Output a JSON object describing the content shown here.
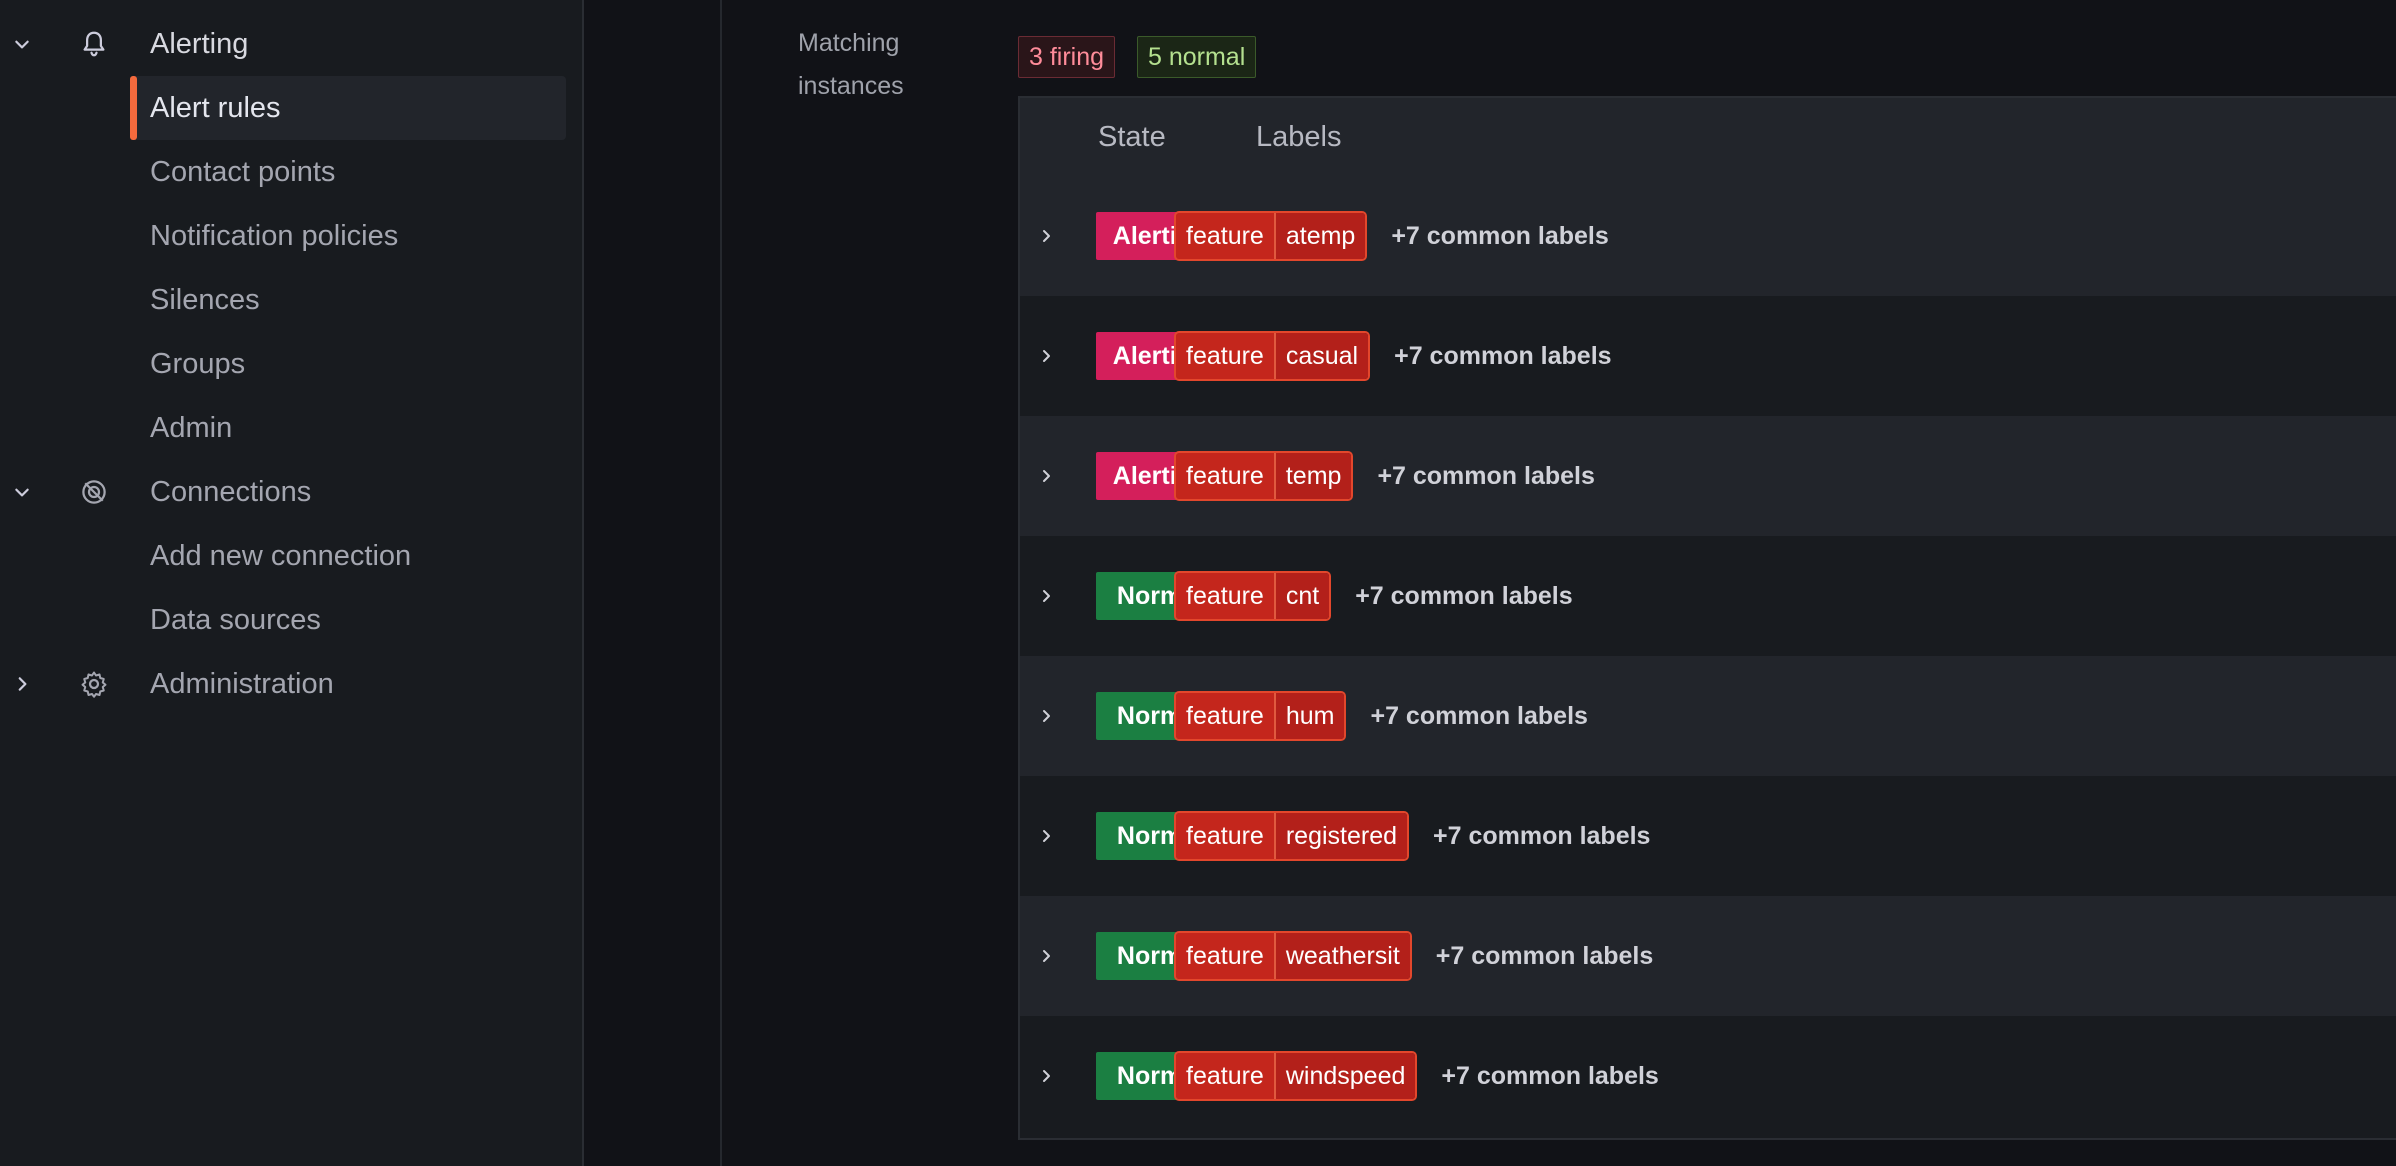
{
  "sidebar": {
    "alerting": {
      "label": "Alerting",
      "icon": "bell-icon",
      "expanded": true
    },
    "alerting_items": [
      {
        "label": "Alert rules",
        "active": true
      },
      {
        "label": "Contact points"
      },
      {
        "label": "Notification policies"
      },
      {
        "label": "Silences"
      },
      {
        "label": "Groups"
      },
      {
        "label": "Admin"
      }
    ],
    "connections": {
      "label": "Connections",
      "icon": "connections-icon",
      "expanded": true
    },
    "connections_items": [
      {
        "label": "Add new connection"
      },
      {
        "label": "Data sources"
      }
    ],
    "administration": {
      "label": "Administration",
      "icon": "gear-icon",
      "expanded": false
    }
  },
  "main": {
    "field_label_line1": "Matching",
    "field_label_line2": "instances",
    "firing_badge": "3 firing",
    "normal_badge": "5 normal",
    "table": {
      "headers": {
        "state": "State",
        "labels": "Labels"
      },
      "rows": [
        {
          "state": "Alerting",
          "label_key": "feature",
          "label_value": "atemp",
          "common": "+7 common labels"
        },
        {
          "state": "Alerting",
          "label_key": "feature",
          "label_value": "casual",
          "common": "+7 common labels"
        },
        {
          "state": "Alerting",
          "label_key": "feature",
          "label_value": "temp",
          "common": "+7 common labels"
        },
        {
          "state": "Normal",
          "label_key": "feature",
          "label_value": "cnt",
          "common": "+7 common labels"
        },
        {
          "state": "Normal",
          "label_key": "feature",
          "label_value": "hum",
          "common": "+7 common labels"
        },
        {
          "state": "Normal",
          "label_key": "feature",
          "label_value": "registered",
          "common": "+7 common labels"
        },
        {
          "state": "Normal",
          "label_key": "feature",
          "label_value": "weathersit",
          "common": "+7 common labels"
        },
        {
          "state": "Normal",
          "label_key": "feature",
          "label_value": "windspeed",
          "common": "+7 common labels"
        }
      ]
    }
  },
  "colors": {
    "accent": "#f46a3d",
    "alerting": "#d41f5b",
    "normal": "#1b7f42",
    "label_chip": "#c4261c"
  }
}
